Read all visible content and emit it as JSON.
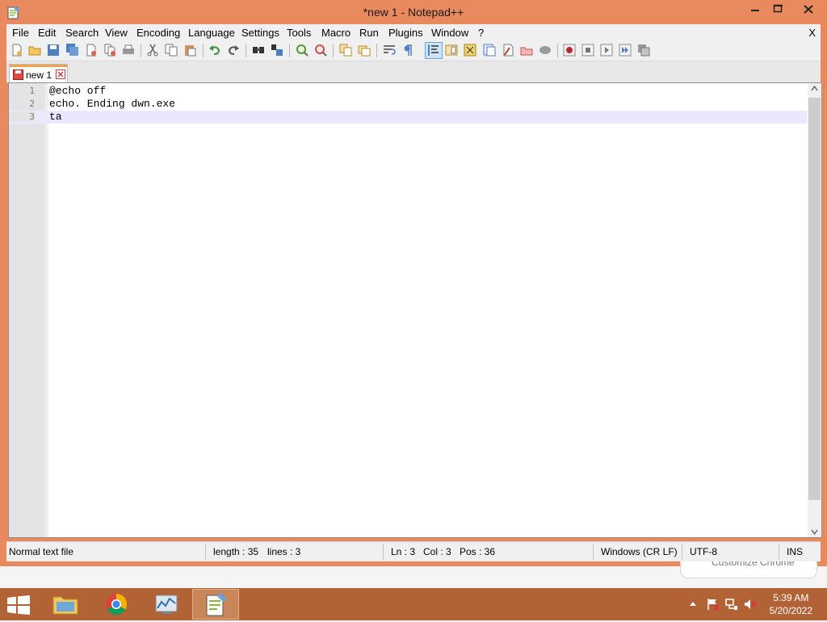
{
  "window": {
    "title": "*new 1 - Notepad++"
  },
  "menu": {
    "items": [
      "File",
      "Edit",
      "Search",
      "View",
      "Encoding",
      "Language",
      "Settings",
      "Tools",
      "Macro",
      "Run",
      "Plugins",
      "Window",
      "?"
    ],
    "close_label": "X"
  },
  "toolbar": {
    "icons": [
      "new-file-icon",
      "open-file-icon",
      "save-icon",
      "save-all-icon",
      "close-file-icon",
      "close-all-icon",
      "print-icon",
      "cut-icon",
      "copy-icon",
      "paste-icon",
      "undo-icon",
      "redo-icon",
      "find-icon",
      "replace-icon",
      "zoom-in-icon",
      "zoom-out-icon",
      "sync-vertical-icon",
      "sync-horizontal-icon",
      "word-wrap-icon",
      "show-all-chars-icon",
      "indent-guide-icon",
      "udl-icon",
      "doc-map-icon",
      "function-list-icon",
      "folder-workspace-icon",
      "monitoring-icon",
      "record-macro-icon",
      "stop-macro-icon",
      "play-macro-icon",
      "run-macro-multiple-icon",
      "save-macro-icon"
    ],
    "active_icon": "indent-guide-icon"
  },
  "tabs": [
    {
      "label": "new 1",
      "modified": true
    }
  ],
  "editor": {
    "lines": [
      {
        "num": "1",
        "text": "@echo off"
      },
      {
        "num": "2",
        "text": "echo. Ending dwn.exe"
      },
      {
        "num": "3",
        "text": "ta"
      }
    ],
    "current_line": 3
  },
  "status": {
    "file_type": "Normal text file",
    "length": "length : 35",
    "lines": "lines : 3",
    "ln": "Ln : 3",
    "col": "Col : 3",
    "pos": "Pos : 36",
    "eol": "Windows (CR LF)",
    "encoding": "UTF-8",
    "mode": "INS"
  },
  "background_popup": {
    "text": "Customize Chrome"
  },
  "taskbar": {
    "apps": [
      "file-explorer",
      "chrome",
      "performance-monitor",
      "notepad-plus-plus"
    ],
    "active_app": "notepad-plus-plus",
    "time": "5:39 AM",
    "date": "5/20/2022"
  },
  "colors": {
    "titlebar": "#e9895e",
    "taskbar": "#b26336",
    "current_line": "#e8e8ff",
    "tab_accent": "#f4a14c"
  }
}
